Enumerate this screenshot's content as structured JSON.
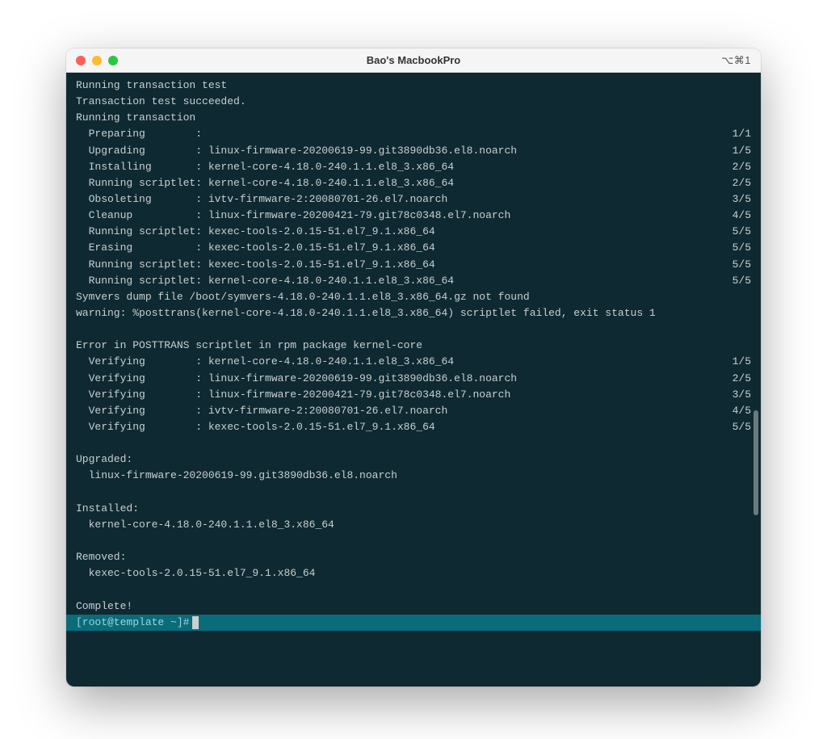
{
  "window": {
    "title": "Bao's MacbookPro",
    "shortcut": "⌥⌘1"
  },
  "output": {
    "headerLines": [
      "Running transaction test",
      "Transaction test succeeded.",
      "Running transaction"
    ],
    "transactionSteps": [
      {
        "label": "  Preparing        :",
        "pkg": "",
        "count": "1/1"
      },
      {
        "label": "  Upgrading        :",
        "pkg": " linux-firmware-20200619-99.git3890db36.el8.noarch",
        "count": "1/5"
      },
      {
        "label": "  Installing       :",
        "pkg": " kernel-core-4.18.0-240.1.1.el8_3.x86_64",
        "count": "2/5"
      },
      {
        "label": "  Running scriptlet:",
        "pkg": " kernel-core-4.18.0-240.1.1.el8_3.x86_64",
        "count": "2/5"
      },
      {
        "label": "  Obsoleting       :",
        "pkg": " ivtv-firmware-2:20080701-26.el7.noarch",
        "count": "3/5"
      },
      {
        "label": "  Cleanup          :",
        "pkg": " linux-firmware-20200421-79.git78c0348.el7.noarch",
        "count": "4/5"
      },
      {
        "label": "  Running scriptlet:",
        "pkg": " kexec-tools-2.0.15-51.el7_9.1.x86_64",
        "count": "5/5"
      },
      {
        "label": "  Erasing          :",
        "pkg": " kexec-tools-2.0.15-51.el7_9.1.x86_64",
        "count": "5/5"
      },
      {
        "label": "  Running scriptlet:",
        "pkg": " kexec-tools-2.0.15-51.el7_9.1.x86_64",
        "count": "5/5"
      },
      {
        "label": "  Running scriptlet:",
        "pkg": " kernel-core-4.18.0-240.1.1.el8_3.x86_64",
        "count": "5/5"
      }
    ],
    "midLines": [
      "Symvers dump file /boot/symvers-4.18.0-240.1.1.el8_3.x86_64.gz not found",
      "warning: %posttrans(kernel-core-4.18.0-240.1.1.el8_3.x86_64) scriptlet failed, exit status 1",
      "",
      "Error in POSTTRANS scriptlet in rpm package kernel-core"
    ],
    "verifySteps": [
      {
        "label": "  Verifying        :",
        "pkg": " kernel-core-4.18.0-240.1.1.el8_3.x86_64",
        "count": "1/5"
      },
      {
        "label": "  Verifying        :",
        "pkg": " linux-firmware-20200619-99.git3890db36.el8.noarch",
        "count": "2/5"
      },
      {
        "label": "  Verifying        :",
        "pkg": " linux-firmware-20200421-79.git78c0348.el7.noarch",
        "count": "3/5"
      },
      {
        "label": "  Verifying        :",
        "pkg": " ivtv-firmware-2:20080701-26.el7.noarch",
        "count": "4/5"
      },
      {
        "label": "  Verifying        :",
        "pkg": " kexec-tools-2.0.15-51.el7_9.1.x86_64",
        "count": "5/5"
      }
    ],
    "summaryLines": [
      "",
      "Upgraded:",
      "  linux-firmware-20200619-99.git3890db36.el8.noarch",
      "",
      "Installed:",
      "  kernel-core-4.18.0-240.1.1.el8_3.x86_64",
      "",
      "Removed:",
      "  kexec-tools-2.0.15-51.el7_9.1.x86_64",
      "",
      "Complete!"
    ],
    "prompt": "[root@template ~]# "
  }
}
